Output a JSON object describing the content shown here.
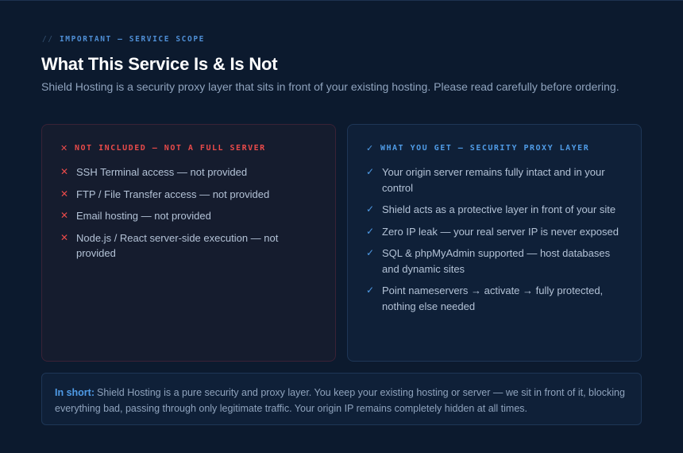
{
  "header": {
    "eyebrow_slashes": "//",
    "eyebrow": "IMPORTANT — SERVICE SCOPE",
    "title": "What This Service Is & Is Not",
    "subtitle": "Shield Hosting is a security proxy layer that sits in front of your existing hosting. Please read carefully before ordering."
  },
  "not_included": {
    "icon": "x-icon",
    "icon_glyph": "✕",
    "heading": "NOT INCLUDED — NOT A FULL SERVER",
    "items": [
      "SSH Terminal access — not provided",
      "FTP / File Transfer access — not provided",
      "Email hosting — not provided",
      "Node.js / React server-side execution — not provided"
    ]
  },
  "included": {
    "icon": "check-icon",
    "icon_glyph": "✓",
    "heading": "WHAT YOU GET — SECURITY PROXY LAYER",
    "items": [
      "Your origin server remains fully intact and in your control",
      "Shield acts as a protective layer in front of your site",
      "Zero IP leak — your real server IP is never exposed",
      "SQL & phpMyAdmin supported — host databases and dynamic sites",
      "Point nameservers → activate → fully protected, nothing else needed"
    ]
  },
  "summary": {
    "lead": "In short:",
    "text": "Shield Hosting is a pure security and proxy layer. You keep your existing hosting or server — we sit in front of it, blocking everything bad, passing through only legitimate traffic. Your origin IP remains completely hidden at all times."
  },
  "colors": {
    "background": "#0c1a2e",
    "danger": "#e84a4a",
    "accent": "#4f9be6",
    "title": "#ffffff"
  }
}
